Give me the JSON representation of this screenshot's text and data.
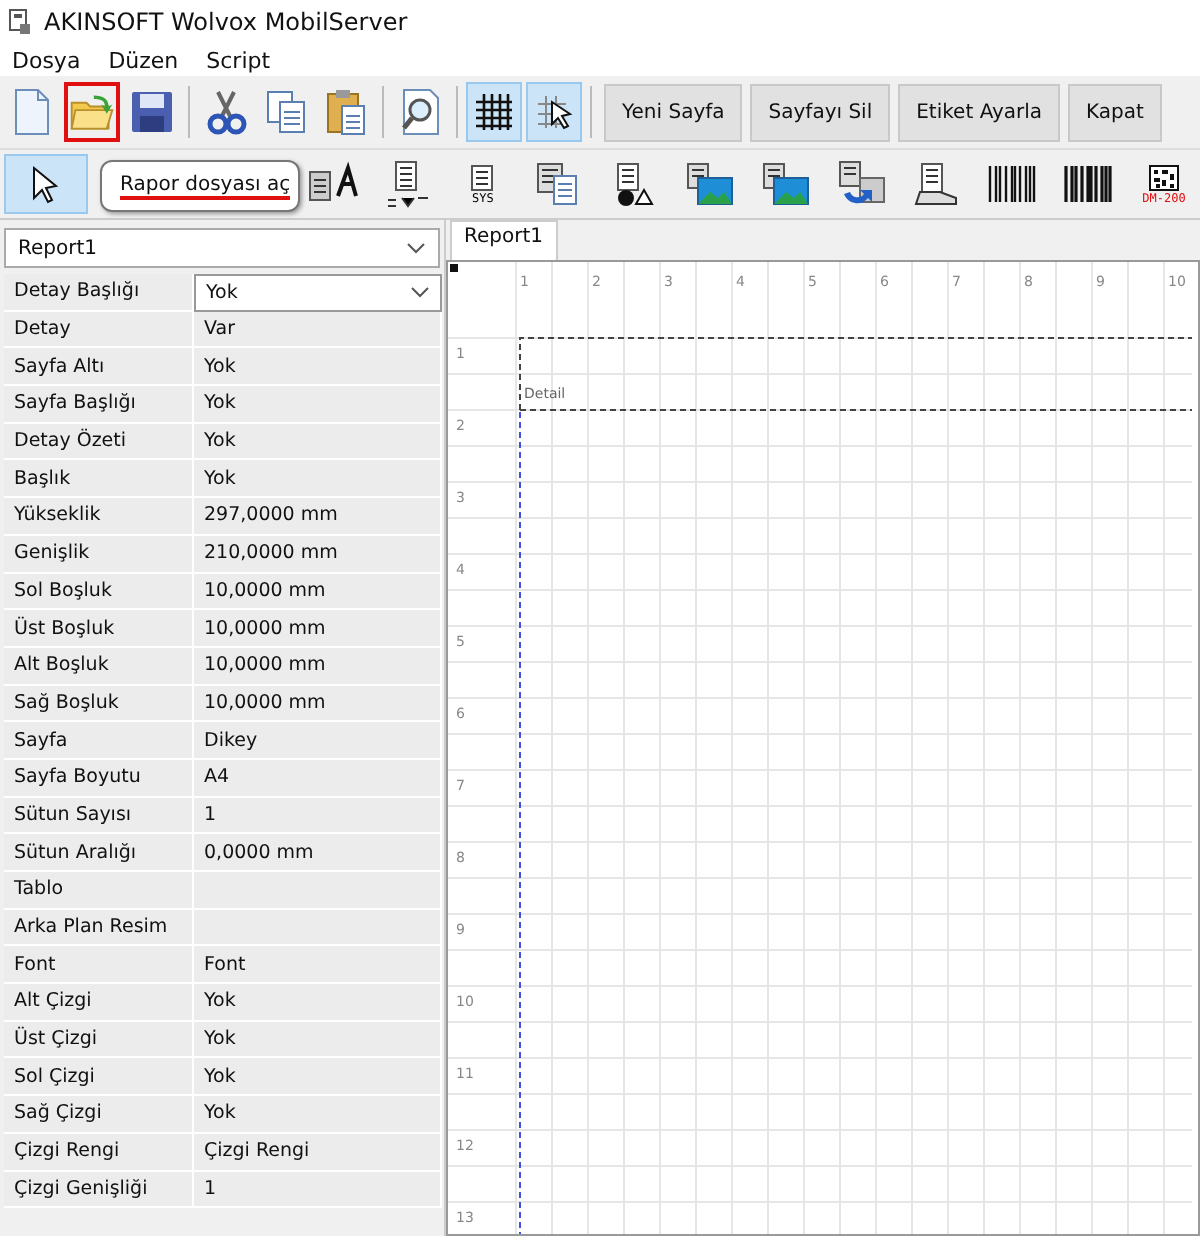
{
  "window": {
    "title": "AKINSOFT Wolvox MobilServer"
  },
  "menu": [
    {
      "label": "Dosya"
    },
    {
      "label": "Düzen"
    },
    {
      "label": "Script"
    }
  ],
  "toolbar": {
    "tools": [
      {
        "kind": "new",
        "selected": false,
        "highlighted": false
      },
      {
        "kind": "open",
        "selected": false,
        "highlighted": true
      },
      {
        "kind": "save",
        "selected": false,
        "highlighted": false
      },
      {
        "kind": "sep"
      },
      {
        "kind": "cut",
        "selected": false,
        "highlighted": false
      },
      {
        "kind": "copy",
        "selected": false,
        "highlighted": false
      },
      {
        "kind": "paste",
        "selected": false,
        "highlighted": false
      },
      {
        "kind": "sep"
      },
      {
        "kind": "preview",
        "selected": false,
        "highlighted": false
      },
      {
        "kind": "sep"
      },
      {
        "kind": "grid",
        "selected": true,
        "highlighted": false
      },
      {
        "kind": "snap",
        "selected": true,
        "highlighted": false
      },
      {
        "kind": "sep"
      }
    ],
    "buttons": [
      "Yeni Sayfa",
      "Sayfayı Sil",
      "Etiket Ayarla",
      "Kapat"
    ]
  },
  "palette": [
    {
      "kind": "pointer",
      "selected": true
    },
    {
      "kind": "label",
      "selected": false
    },
    {
      "kind": "formula",
      "selected": false
    },
    {
      "kind": "system",
      "selected": false,
      "caption": "SYS"
    },
    {
      "kind": "memo",
      "selected": false
    },
    {
      "kind": "shape",
      "selected": false
    },
    {
      "kind": "image",
      "selected": false
    },
    {
      "kind": "dbimage",
      "selected": false
    },
    {
      "kind": "richtext",
      "selected": false
    },
    {
      "kind": "region",
      "selected": false
    },
    {
      "kind": "barcode",
      "selected": false
    },
    {
      "kind": "barcode2",
      "selected": false
    },
    {
      "kind": "datamatrix",
      "selected": false,
      "caption": "DM-200"
    }
  ],
  "tooltip": {
    "text": "Rapor dosyası aç"
  },
  "report_select": {
    "value": "Report1"
  },
  "properties": [
    {
      "name": "Detay Başlığı",
      "value": "Yok",
      "kind": "dropdown"
    },
    {
      "name": "Detay",
      "value": "Var",
      "kind": "text"
    },
    {
      "name": "Sayfa Altı",
      "value": "Yok",
      "kind": "text"
    },
    {
      "name": "Sayfa Başlığı",
      "value": "Yok",
      "kind": "text"
    },
    {
      "name": "Detay Özeti",
      "value": "Yok",
      "kind": "text"
    },
    {
      "name": "Başlık",
      "value": "Yok",
      "kind": "text"
    },
    {
      "name": "Yükseklik",
      "value": "297,0000 mm",
      "kind": "text"
    },
    {
      "name": "Genişlik",
      "value": "210,0000 mm",
      "kind": "text"
    },
    {
      "name": "Sol Boşluk",
      "value": "10,0000 mm",
      "kind": "text"
    },
    {
      "name": "Üst Boşluk",
      "value": "10,0000 mm",
      "kind": "text"
    },
    {
      "name": "Alt Boşluk",
      "value": "10,0000 mm",
      "kind": "text"
    },
    {
      "name": "Sağ Boşluk",
      "value": "10,0000 mm",
      "kind": "text"
    },
    {
      "name": "Sayfa",
      "value": "Dikey",
      "kind": "text"
    },
    {
      "name": "Sayfa Boyutu",
      "value": "A4",
      "kind": "text"
    },
    {
      "name": "Sütun Sayısı",
      "value": "1",
      "kind": "text"
    },
    {
      "name": "Sütun Aralığı",
      "value": "0,0000 mm",
      "kind": "text"
    },
    {
      "name": "Tablo",
      "kind": "text"
    },
    {
      "name": "Arka Plan Resim",
      "kind": "text"
    },
    {
      "name": "Font",
      "value": "Font",
      "kind": "text"
    },
    {
      "name": "Alt Çizgi",
      "value": "Yok",
      "kind": "text"
    },
    {
      "name": "Üst Çizgi",
      "value": "Yok",
      "kind": "text"
    },
    {
      "name": "Sol Çizgi",
      "value": "Yok",
      "kind": "text"
    },
    {
      "name": "Sağ Çizgi",
      "value": "Yok",
      "kind": "text"
    },
    {
      "name": "Çizgi Rengi",
      "value": "Çizgi Rengi",
      "kind": "text"
    },
    {
      "name": "Çizgi Genişliği",
      "value": "1",
      "kind": "text"
    }
  ],
  "tabs": [
    {
      "label": "Report1",
      "selected": true
    }
  ],
  "designer": {
    "x_ruler": [
      "1",
      "2",
      "3",
      "4",
      "5",
      "6",
      "7",
      "8",
      "9",
      "10"
    ],
    "y_ruler": [
      "1",
      "2",
      "3",
      "4",
      "5",
      "6",
      "7",
      "8",
      "9",
      "10",
      "11",
      "12",
      "13"
    ],
    "band": {
      "label": "Detail"
    }
  }
}
